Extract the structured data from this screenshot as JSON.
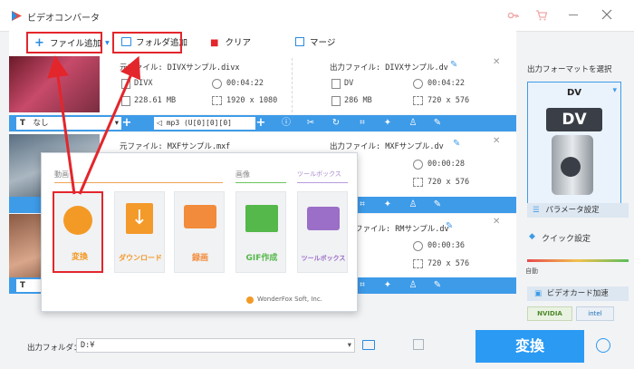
{
  "app": {
    "title": "ビデオコンバータ"
  },
  "toolbar": {
    "add_file": "ファイル追加",
    "add_folder": "フォルダ追加",
    "clear": "クリア",
    "merge": "マージ"
  },
  "files": [
    {
      "source_name": "元ファイル: DIVXサンプル.divx",
      "source_format": "DIVX",
      "source_duration": "00:04:22",
      "source_size": "228.61 MB",
      "source_resolution": "1920 x 1080",
      "output_name": "出力ファイル: DIVXサンプル.dv",
      "output_format": "DV",
      "output_duration": "00:04:22",
      "output_size": "286 MB",
      "output_resolution": "720 x 576",
      "subtitle": "なし",
      "audio": "mp3 (U[0][0][0]"
    },
    {
      "source_name": "元ファイル: MXFサンプル.mxf",
      "output_name": "出力ファイル: MXFサンプル.dv",
      "output_duration": "00:00:28",
      "output_resolution": "720 x 576"
    },
    {
      "output_name": "ファイル: RMサンプル.dv",
      "output_duration": "00:00:36",
      "output_resolution": "720 x 576"
    }
  ],
  "popup": {
    "sections": [
      "動画",
      "画像",
      "ツールボックス"
    ],
    "tools": [
      "変換",
      "ダウンロード",
      "録画",
      "GIF作成",
      "ツールボックス"
    ],
    "brand": "WonderFox Soft, Inc."
  },
  "right_panel": {
    "heading": "出力フォーマットを選択",
    "format": "DV",
    "format_icon_text": "DV",
    "param_settings": "パラメータ設定",
    "quick_settings": "クイック設定",
    "slider_label": "自動",
    "gpu_accel": "ビデオカード加速",
    "nvidia": "NVIDIA",
    "intel": "intel"
  },
  "bottom": {
    "output_folder_label": "出力フォルダ：",
    "output_folder_value": "D:¥",
    "convert_button": "変換"
  },
  "colors": {
    "accent_blue": "#3e9be8",
    "convert_blue": "#2b9af3",
    "highlight_red": "#e3262c",
    "convert_orange": "#f39a26",
    "download_orange": "#f39a2a",
    "record_orange": "#f28b3b",
    "gif_green": "#55b84a",
    "toolbox_purple": "#9b6ec8"
  }
}
